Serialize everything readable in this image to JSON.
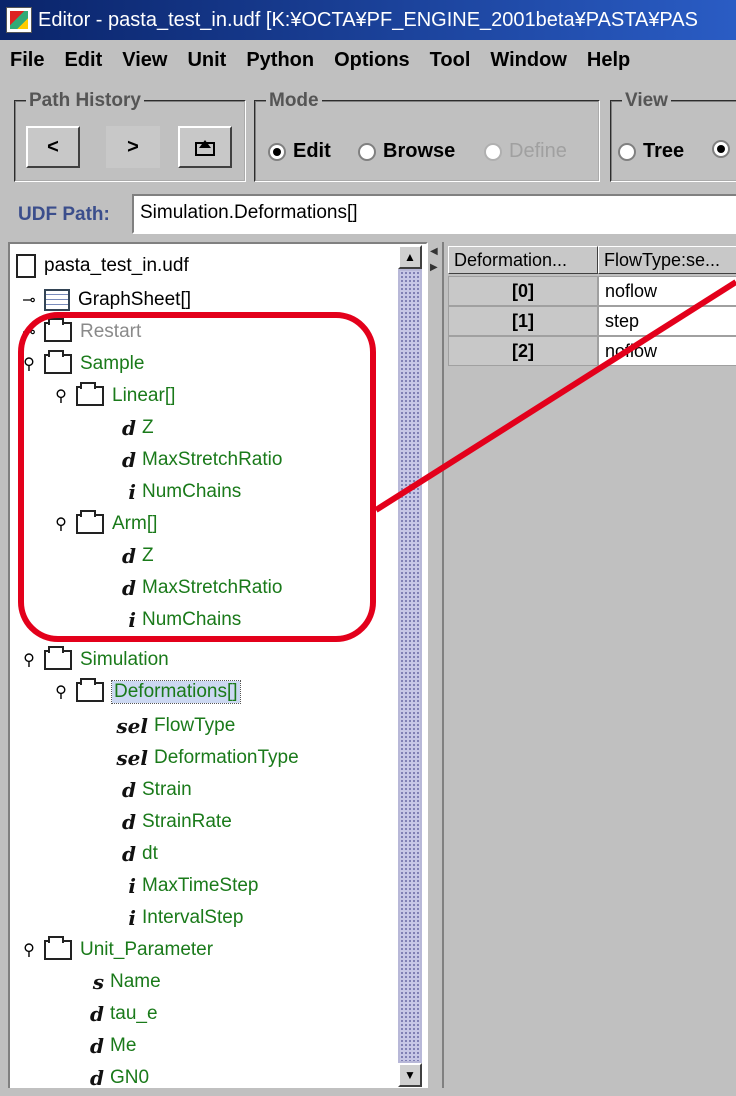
{
  "window": {
    "title": "Editor - pasta_test_in.udf [K:¥OCTA¥PF_ENGINE_2001beta¥PASTA¥PAS"
  },
  "menu": [
    "File",
    "Edit",
    "View",
    "Unit",
    "Python",
    "Options",
    "Tool",
    "Window",
    "Help"
  ],
  "path_history": {
    "legend": "Path History",
    "back_label": "<",
    "forward_label": ">"
  },
  "mode": {
    "legend": "Mode",
    "options": [
      {
        "label": "Edit",
        "selected": true,
        "enabled": true
      },
      {
        "label": "Browse",
        "selected": false,
        "enabled": true
      },
      {
        "label": "Define",
        "selected": false,
        "enabled": false
      }
    ]
  },
  "view": {
    "legend": "View",
    "options": [
      {
        "label": "Tree",
        "selected": false
      },
      {
        "label": "",
        "selected": true
      }
    ]
  },
  "udf_path": {
    "label": "UDF Path:",
    "value": "Simulation.Deformations[]"
  },
  "tree": [
    {
      "label": "pasta_test_in.udf",
      "icon": "document-icon",
      "depth": 0
    },
    {
      "label": "GraphSheet[]",
      "icon": "sheet-icon",
      "depth": 0,
      "expander": "collapsed"
    },
    {
      "label": "Restart",
      "icon": "folder-icon",
      "depth": 0,
      "expander": "collapsed"
    },
    {
      "label": "Sample",
      "icon": "folder-icon",
      "depth": 0,
      "expander": "expanded"
    },
    {
      "label": "Linear[]",
      "icon": "folder-icon",
      "depth": 1,
      "expander": "expanded"
    },
    {
      "label": "Z",
      "type": "d",
      "depth": 2
    },
    {
      "label": "MaxStretchRatio",
      "type": "d",
      "depth": 2
    },
    {
      "label": "NumChains",
      "type": "i",
      "depth": 2
    },
    {
      "label": "Arm[]",
      "icon": "folder-icon",
      "depth": 1,
      "expander": "expanded"
    },
    {
      "label": "Z",
      "type": "d",
      "depth": 2
    },
    {
      "label": "MaxStretchRatio",
      "type": "d",
      "depth": 2
    },
    {
      "label": "NumChains",
      "type": "i",
      "depth": 2
    },
    {
      "label": "Simulation",
      "icon": "folder-icon",
      "depth": 0,
      "expander": "expanded"
    },
    {
      "label": "Deformations[]",
      "icon": "folder-icon",
      "depth": 1,
      "expander": "expanded",
      "selected": true
    },
    {
      "label": "FlowType",
      "type": "sel",
      "depth": 2
    },
    {
      "label": "DeformationType",
      "type": "sel",
      "depth": 2
    },
    {
      "label": "Strain",
      "type": "d",
      "depth": 2
    },
    {
      "label": "StrainRate",
      "type": "d",
      "depth": 2
    },
    {
      "label": "dt",
      "type": "d",
      "depth": 2
    },
    {
      "label": "MaxTimeStep",
      "type": "i",
      "depth": 2
    },
    {
      "label": "IntervalStep",
      "type": "i",
      "depth": 2
    },
    {
      "label": "Unit_Parameter",
      "icon": "folder-icon",
      "depth": 0,
      "expander": "expanded"
    },
    {
      "label": "Name",
      "type": "s",
      "depth": 1
    },
    {
      "label": "tau_e",
      "type": "d",
      "depth": 1
    },
    {
      "label": "Me",
      "type": "d",
      "depth": 1
    },
    {
      "label": "GN0",
      "type": "d",
      "depth": 1
    }
  ],
  "table": {
    "headers": [
      "Deformation...",
      "FlowType:se..."
    ],
    "rows": [
      {
        "index": "[0]",
        "value": "noflow"
      },
      {
        "index": "[1]",
        "value": "step"
      },
      {
        "index": "[2]",
        "value": "noflow"
      }
    ]
  },
  "annotation_color": "#e3001b"
}
